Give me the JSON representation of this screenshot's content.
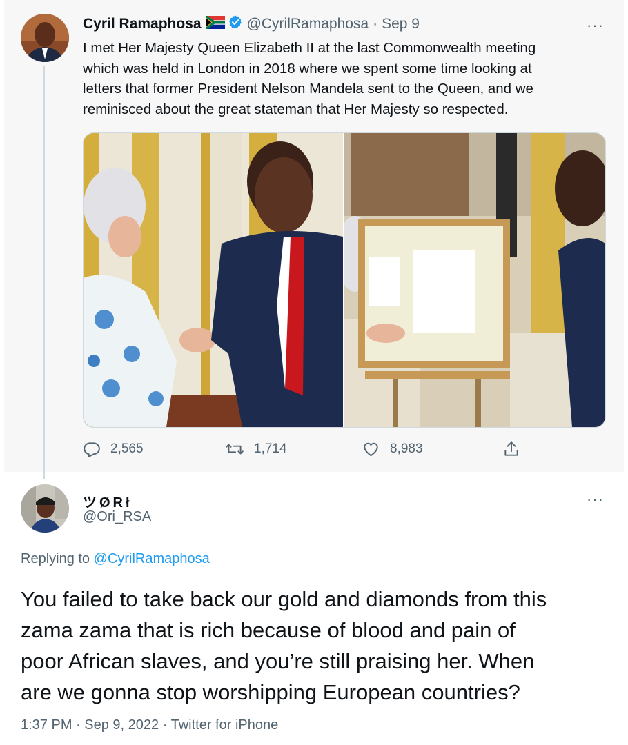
{
  "tweet": {
    "author_name": "Cyril Ramaphosa",
    "flag_icon": "south-africa-flag-icon",
    "verified_icon": "verified-badge-icon",
    "handle": "@CyrilRamaphosa",
    "separator": "·",
    "date": "Sep 9",
    "more_icon": "more-options-icon",
    "more_label": "···",
    "text_lines": [
      "I met Her Majesty Queen Elizabeth II at the last Commonwealth meeting",
      "which was held in London in 2018 where we spent some time looking  at",
      "letters that former President Nelson Mandela sent to the Queen, and we",
      "reminisced about the great stateman that Her Majesty so respected."
    ],
    "stats": {
      "replies": "2,565",
      "retweets": "1,714",
      "likes": "8,983"
    }
  },
  "reply": {
    "author_name": "ツØRł",
    "handle": "@Ori_RSA",
    "more_label": "···",
    "replying_prefix": "Replying to",
    "replying_to": "@CyrilRamaphosa",
    "text_lines": [
      "You failed to take back our gold and diamonds from this",
      "zama zama that is rich because of blood and pain of",
      "poor African slaves, and you’re still praising her. When",
      "are we gonna stop worshipping European countries?"
    ],
    "time": "1:37 PM",
    "separator": "·",
    "date": "Sep 9, 2022",
    "source": "Twitter for iPhone"
  },
  "colors": {
    "accent": "#1d9bf0",
    "secondary_text": "#536471",
    "primary_text": "#0f1419",
    "parent_background": "#f7f7f7"
  }
}
